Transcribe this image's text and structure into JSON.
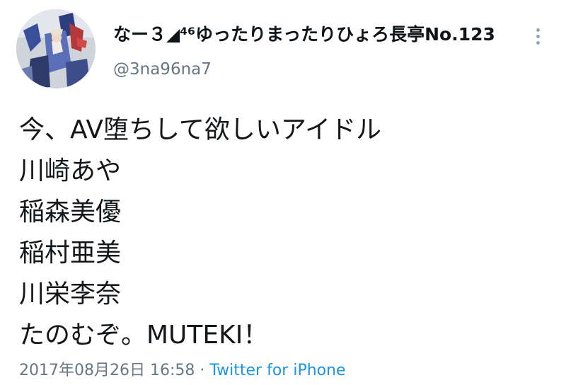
{
  "author": {
    "display_name": "なー３◢⁴⁶ゆったりまったりひょろ長亭No.123",
    "username": "@3na96na7"
  },
  "tweet": {
    "lines": [
      "今、AV堕ちして欲しいアイドル",
      "川崎あや",
      "稲森美優",
      "稲村亜美",
      "川栄李奈",
      "たのむぞ。MUTEKI！"
    ]
  },
  "meta": {
    "timestamp": "2017年08月26日 16:58",
    "separator": " · ",
    "source": "Twitter for iPhone"
  },
  "icons": {
    "more": "more-vertical-icon",
    "avatar": "avatar-image"
  },
  "colors": {
    "link": "#1b95e0",
    "secondary_text": "#657786",
    "primary_text": "#0f1419"
  }
}
